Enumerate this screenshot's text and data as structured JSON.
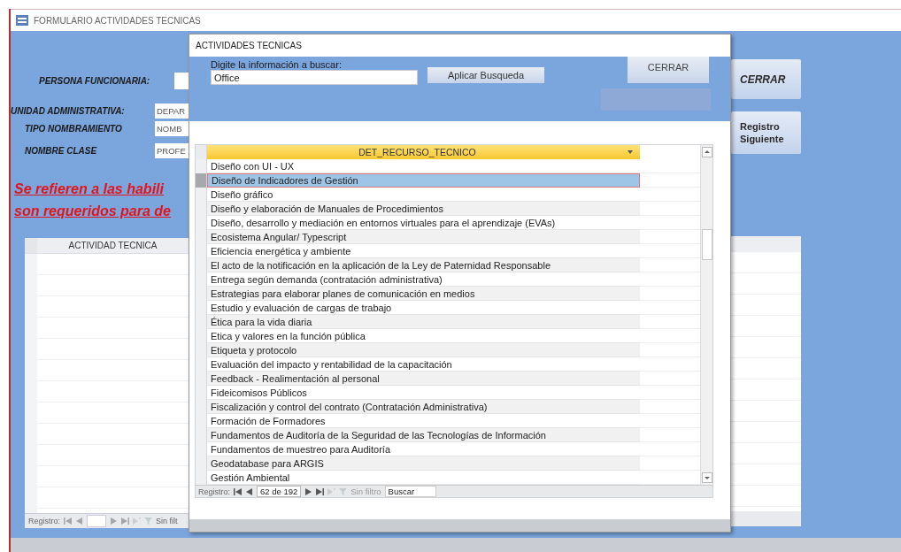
{
  "background_window": {
    "title": "FORMULARIO ACTIVIDADES TECNICAS",
    "fields": [
      {
        "label": "PERSONA FUNCIONARIA:"
      },
      {
        "label": "UNIDAD ADMINISTRATIVA:",
        "value": "DEPAR"
      },
      {
        "label": "TIPO NOMBRAMIENTO",
        "value": "NOMB"
      },
      {
        "label": "NOMBRE CLASE",
        "value": "PROFE"
      }
    ],
    "notice_lines": [
      "Se refieren a las habili",
      "son requeridos para de"
    ],
    "buttons": [
      {
        "label": "CERRAR",
        "kind": "close"
      },
      {
        "label": "Registro Siguiente",
        "kind": "next"
      }
    ],
    "subform": {
      "column": "ACTIVIDAD TECNICA",
      "nav": {
        "label": "Registro:",
        "filter": "Sin filt"
      }
    }
  },
  "dialog": {
    "title": "ACTIVIDADES TECNICAS",
    "search": {
      "label": "Digite la información a buscar:",
      "value": "Office"
    },
    "apply_button": "Aplicar Busqueda",
    "close_button": "CERRAR",
    "grid": {
      "column": "DET_RECURSO_TECNICO",
      "rows": [
        {
          "text": "Diseño con UI - UX",
          "selected": false
        },
        {
          "text": "Diseño de Indicadores de Gestión",
          "selected": true
        },
        {
          "text": "Diseño gráfico",
          "selected": false
        },
        {
          "text": "Diseño y elaboración de Manuales de Procedimientos",
          "selected": false
        },
        {
          "text": "Diseño, desarrollo y mediación en entornos virtuales para el aprendizaje (EVAs)",
          "selected": false
        },
        {
          "text": "Ecosistema Angular/ Typescript",
          "selected": false
        },
        {
          "text": "Eficiencia energética y ambiente",
          "selected": false
        },
        {
          "text": "El acto de la notificación en la aplicación de la Ley de Paternidad Responsable",
          "selected": false
        },
        {
          "text": "Entrega según demanda (contratación administrativa)",
          "selected": false
        },
        {
          "text": "Estrategias para elaborar planes de comunicación en medios",
          "selected": false
        },
        {
          "text": "Estudio y evaluación de cargas de trabajo",
          "selected": false
        },
        {
          "text": "Ética para la vida diaria",
          "selected": false
        },
        {
          "text": "Etica y valores en la función pública",
          "selected": false
        },
        {
          "text": "Etiqueta y protocolo",
          "selected": false
        },
        {
          "text": "Evaluación del impacto y rentabilidad de la capacitación",
          "selected": false
        },
        {
          "text": "Feedback - Realimentación al personal",
          "selected": false
        },
        {
          "text": "Fideicomisos Públicos",
          "selected": false
        },
        {
          "text": "Fiscalización y control del contrato (Contratación Administrativa)",
          "selected": false
        },
        {
          "text": "Formación de Formadores",
          "selected": false
        },
        {
          "text": "Fundamentos de Auditoría de la Seguridad de las Tecnologías de Información",
          "selected": false
        },
        {
          "text": "Fundamentos de muestreo para Auditoría",
          "selected": false
        },
        {
          "text": "Geodatabase para ARGIS",
          "selected": false
        },
        {
          "text": "Gestión Ambiental",
          "selected": false
        }
      ],
      "nav": {
        "label": "Registro:",
        "position": "62 de 192",
        "filter": "Sin filtro",
        "search": "Buscar"
      }
    }
  }
}
